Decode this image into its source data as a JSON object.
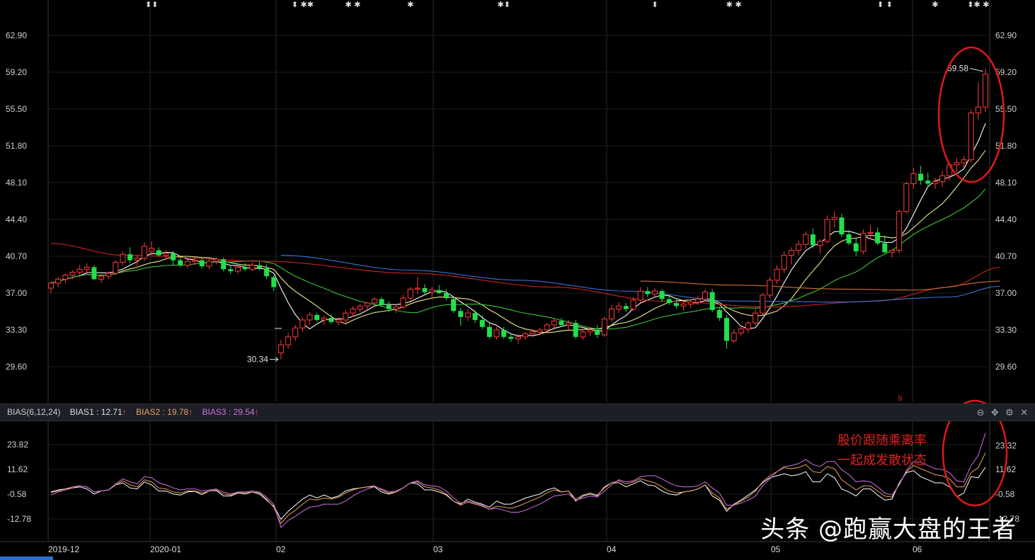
{
  "price_axis_ticks": [
    "62.90",
    "59.20",
    "55.50",
    "51.80",
    "48.10",
    "44.40",
    "40.70",
    "37.00",
    "33.30",
    "29.60"
  ],
  "bias_axis_ticks": [
    "23.82",
    "11.62",
    "-0.58",
    "-12.78"
  ],
  "bias_axis_ticks_right": [
    "23.32",
    "11.62",
    "-0.58",
    "-12.78"
  ],
  "date_labels": [
    "2019-12",
    "2020-01",
    "02",
    "03",
    "04",
    "05",
    "06"
  ],
  "indicator_bar": {
    "name": "BIAS(6,12,24)",
    "bias1": "BIAS1 : 12.71",
    "bias2": "BIAS2 : 19.78",
    "bias3": "BIAS3 : 29.54",
    "arrow": "↑"
  },
  "annotations": {
    "low_label": "30.34",
    "high_label": "59.58",
    "note_line1": "股价跟随乘离率",
    "note_line2": "一起成发散状态",
    "marker_9": "9"
  },
  "watermark": "头条 @跑赢大盘的王者",
  "colors": {
    "up": "#ff3b3b",
    "down": "#22e04a",
    "bias1": "#ffffff",
    "bias2": "#e8a060",
    "bias3": "#d070e0",
    "ma5": "#ffffff",
    "ma10": "#f0e68c",
    "ma20": "#3cc43c",
    "ma60": "#cc2222",
    "ma120": "#3a6fd8",
    "ma250": "#d07030"
  },
  "chart_data": {
    "type": "candlestick",
    "price_range": [
      27.5,
      64.5
    ],
    "candles_ohlc": [
      [
        37.5,
        38.2,
        37.0,
        38.0
      ],
      [
        38.0,
        38.6,
        37.6,
        38.4
      ],
      [
        38.4,
        39.0,
        38.0,
        38.8
      ],
      [
        38.8,
        39.3,
        38.4,
        39.1
      ],
      [
        39.1,
        39.8,
        38.6,
        39.4
      ],
      [
        39.4,
        40.0,
        38.9,
        39.6
      ],
      [
        39.6,
        39.8,
        38.3,
        38.4
      ],
      [
        38.4,
        38.9,
        38.0,
        38.7
      ],
      [
        38.7,
        39.2,
        38.4,
        39.0
      ],
      [
        39.0,
        40.3,
        38.8,
        40.1
      ],
      [
        40.1,
        41.2,
        39.8,
        40.9
      ],
      [
        40.9,
        41.6,
        40.0,
        40.3
      ],
      [
        40.3,
        40.8,
        39.7,
        40.5
      ],
      [
        40.5,
        42.1,
        40.2,
        41.7
      ],
      [
        41.2,
        42.2,
        40.8,
        41.5
      ],
      [
        41.3,
        41.6,
        40.7,
        40.8
      ],
      [
        40.8,
        41.3,
        40.3,
        41.0
      ],
      [
        41.0,
        41.2,
        39.8,
        40.3
      ],
      [
        40.3,
        40.6,
        39.6,
        39.8
      ],
      [
        39.8,
        40.4,
        39.5,
        40.2
      ],
      [
        40.2,
        40.6,
        39.8,
        40.3
      ],
      [
        40.3,
        40.5,
        39.5,
        39.7
      ],
      [
        39.7,
        40.5,
        39.4,
        40.2
      ],
      [
        40.2,
        40.6,
        39.9,
        40.4
      ],
      [
        40.4,
        40.6,
        39.2,
        39.4
      ],
      [
        39.4,
        39.7,
        38.9,
        39.2
      ],
      [
        39.2,
        39.8,
        38.9,
        39.6
      ],
      [
        39.6,
        40.0,
        39.2,
        39.4
      ],
      [
        39.4,
        40.1,
        39.2,
        39.8
      ],
      [
        39.8,
        40.2,
        39.3,
        39.5
      ],
      [
        39.5,
        39.9,
        38.4,
        38.7
      ],
      [
        38.6,
        38.8,
        37.2,
        37.6
      ],
      [
        31.0,
        32.3,
        30.34,
        31.8
      ],
      [
        31.8,
        33.0,
        31.4,
        32.6
      ],
      [
        32.6,
        33.8,
        32.2,
        33.5
      ],
      [
        33.5,
        34.6,
        33.1,
        34.3
      ],
      [
        34.3,
        35.1,
        33.8,
        34.8
      ],
      [
        34.8,
        35.0,
        34.1,
        34.3
      ],
      [
        34.3,
        34.7,
        33.8,
        34.5
      ],
      [
        34.5,
        34.9,
        33.9,
        34.1
      ],
      [
        34.1,
        34.6,
        33.7,
        34.3
      ],
      [
        34.3,
        35.3,
        34.0,
        35.0
      ],
      [
        35.0,
        35.7,
        34.6,
        35.4
      ],
      [
        35.4,
        35.9,
        35.1,
        35.7
      ],
      [
        35.7,
        36.1,
        35.3,
        36.0
      ],
      [
        36.0,
        36.6,
        35.6,
        36.4
      ],
      [
        36.4,
        36.6,
        35.6,
        35.8
      ],
      [
        35.8,
        36.2,
        35.1,
        35.4
      ],
      [
        35.4,
        35.9,
        35.0,
        35.6
      ],
      [
        35.6,
        36.8,
        35.4,
        36.5
      ],
      [
        36.5,
        37.6,
        36.2,
        37.4
      ],
      [
        37.4,
        38.6,
        36.9,
        37.5
      ],
      [
        37.5,
        37.9,
        36.8,
        37.1
      ],
      [
        37.1,
        37.6,
        36.5,
        37.3
      ],
      [
        37.3,
        37.8,
        36.9,
        37.0
      ],
      [
        37.0,
        37.4,
        36.3,
        36.5
      ],
      [
        36.4,
        36.6,
        35.0,
        35.2
      ],
      [
        35.2,
        35.5,
        33.7,
        34.6
      ],
      [
        34.6,
        35.4,
        34.2,
        35.0
      ],
      [
        35.0,
        35.3,
        34.0,
        34.3
      ],
      [
        34.3,
        34.8,
        33.4,
        33.6
      ],
      [
        33.6,
        34.0,
        32.4,
        32.6
      ],
      [
        32.6,
        33.6,
        32.3,
        33.3
      ],
      [
        33.3,
        33.6,
        32.4,
        32.6
      ],
      [
        32.6,
        33.0,
        32.1,
        32.4
      ],
      [
        32.4,
        32.9,
        31.9,
        32.6
      ],
      [
        32.6,
        33.1,
        32.3,
        32.9
      ],
      [
        32.9,
        33.4,
        32.6,
        33.1
      ],
      [
        33.1,
        33.5,
        32.8,
        33.3
      ],
      [
        33.3,
        34.0,
        33.0,
        33.8
      ],
      [
        33.8,
        34.4,
        33.5,
        34.2
      ],
      [
        34.2,
        34.5,
        33.6,
        33.8
      ],
      [
        33.8,
        34.3,
        33.3,
        34.0
      ],
      [
        34.0,
        34.3,
        32.4,
        32.6
      ],
      [
        32.6,
        33.4,
        32.3,
        33.1
      ],
      [
        33.1,
        33.6,
        32.7,
        33.3
      ],
      [
        33.3,
        33.8,
        32.5,
        32.8
      ],
      [
        32.8,
        34.6,
        32.6,
        34.4
      ],
      [
        34.4,
        35.8,
        34.1,
        35.4
      ],
      [
        35.4,
        36.1,
        35.0,
        35.7
      ],
      [
        35.7,
        36.0,
        35.1,
        35.4
      ],
      [
        35.4,
        36.6,
        35.2,
        36.3
      ],
      [
        36.3,
        37.6,
        36.0,
        37.2
      ],
      [
        37.2,
        37.6,
        36.6,
        36.9
      ],
      [
        36.9,
        37.5,
        36.6,
        37.2
      ],
      [
        37.2,
        37.4,
        36.1,
        36.4
      ],
      [
        36.4,
        36.8,
        35.8,
        36.0
      ],
      [
        36.0,
        36.5,
        35.4,
        35.7
      ],
      [
        35.7,
        36.2,
        35.2,
        35.9
      ],
      [
        35.9,
        36.4,
        35.5,
        36.1
      ],
      [
        36.1,
        36.7,
        35.8,
        36.4
      ],
      [
        36.4,
        37.4,
        36.2,
        37.1
      ],
      [
        37.1,
        37.4,
        35.1,
        35.3
      ],
      [
        35.3,
        35.6,
        34.2,
        34.5
      ],
      [
        34.5,
        34.8,
        31.4,
        32.2
      ],
      [
        32.2,
        33.3,
        32.0,
        33.0
      ],
      [
        33.0,
        33.6,
        32.7,
        33.4
      ],
      [
        33.4,
        34.2,
        33.0,
        34.0
      ],
      [
        34.0,
        35.4,
        33.8,
        35.0
      ],
      [
        35.0,
        37.0,
        34.8,
        36.8
      ],
      [
        36.8,
        38.6,
        36.5,
        38.3
      ],
      [
        38.3,
        39.8,
        37.9,
        39.4
      ],
      [
        39.4,
        41.2,
        39.0,
        40.8
      ],
      [
        40.8,
        41.6,
        39.9,
        41.3
      ],
      [
        41.3,
        42.3,
        40.8,
        41.9
      ],
      [
        41.9,
        43.2,
        41.5,
        42.9
      ],
      [
        42.9,
        43.5,
        41.5,
        41.8
      ],
      [
        41.8,
        42.4,
        41.0,
        42.2
      ],
      [
        42.2,
        44.8,
        42.0,
        44.4
      ],
      [
        44.4,
        45.2,
        43.6,
        44.6
      ],
      [
        44.6,
        45.0,
        42.6,
        42.9
      ],
      [
        42.9,
        43.3,
        41.8,
        42.0
      ],
      [
        42.0,
        42.6,
        40.7,
        41.2
      ],
      [
        41.2,
        43.4,
        40.9,
        43.0
      ],
      [
        43.0,
        43.8,
        42.4,
        43.1
      ],
      [
        43.1,
        43.6,
        41.8,
        42.0
      ],
      [
        42.0,
        42.8,
        40.9,
        41.1
      ],
      [
        41.1,
        41.4,
        40.6,
        41.3
      ],
      [
        41.3,
        45.4,
        41.0,
        45.2
      ],
      [
        45.2,
        48.2,
        45.0,
        48.0
      ],
      [
        48.0,
        49.6,
        47.5,
        49.0
      ],
      [
        49.0,
        49.8,
        47.9,
        48.3
      ],
      [
        48.3,
        49.1,
        47.6,
        48.0
      ],
      [
        48.0,
        48.6,
        47.5,
        48.2
      ],
      [
        48.2,
        49.3,
        47.7,
        48.8
      ],
      [
        48.8,
        50.2,
        48.3,
        49.9
      ],
      [
        49.9,
        50.6,
        49.2,
        50.1
      ],
      [
        50.1,
        50.8,
        49.6,
        50.4
      ],
      [
        50.4,
        55.4,
        50.1,
        55.1
      ],
      [
        55.1,
        58.2,
        54.4,
        55.7
      ],
      [
        55.7,
        59.58,
        55.2,
        59.0
      ]
    ],
    "bias_series": [
      {
        "name": "BIAS1",
        "color": "#ffffff",
        "values": [
          0.5,
          1.5,
          2.0,
          2.5,
          3.0,
          2.0,
          -0.5,
          1.0,
          1.5,
          4.0,
          5.0,
          2.5,
          2.0,
          5.5,
          4.0,
          1.0,
          1.0,
          -0.5,
          -1.0,
          0.5,
          0.8,
          -0.8,
          1.0,
          1.2,
          -1.5,
          -1.5,
          0.0,
          -0.5,
          0.5,
          -0.5,
          -3.5,
          -6.5,
          -13.0,
          -9.0,
          -6.0,
          -3.0,
          -1.0,
          -2.5,
          -1.0,
          -2.5,
          -1.5,
          1.0,
          2.0,
          2.5,
          3.0,
          3.0,
          0.5,
          -0.5,
          0.5,
          2.5,
          5.0,
          4.5,
          1.5,
          1.5,
          0.5,
          -1.0,
          -4.0,
          -5.5,
          -3.0,
          -4.5,
          -5.5,
          -7.0,
          -4.0,
          -5.5,
          -5.5,
          -4.0,
          -2.5,
          -1.5,
          -0.5,
          1.5,
          2.5,
          0.5,
          1.0,
          -4.0,
          -1.5,
          -0.5,
          -1.5,
          3.0,
          5.0,
          5.0,
          3.0,
          4.5,
          6.0,
          4.0,
          3.5,
          1.0,
          -0.5,
          -1.0,
          0.5,
          1.0,
          2.0,
          4.0,
          -1.5,
          -3.5,
          -9.0,
          -5.5,
          -3.5,
          -1.0,
          1.5,
          5.0,
          7.5,
          8.5,
          9.5,
          8.5,
          9.0,
          10.5,
          5.5,
          5.5,
          9.5,
          7.5,
          2.0,
          0.5,
          -1.5,
          2.0,
          2.0,
          -1.0,
          -3.5,
          -3.0,
          5.0,
          10.0,
          11.0,
          8.0,
          6.5,
          5.0,
          5.0,
          3.0,
          -2.0,
          0.0,
          8.0,
          7.5,
          12.71
        ]
      },
      {
        "name": "BIAS2",
        "color": "#e8a060",
        "values": [
          0.2,
          1.0,
          2.0,
          3.0,
          3.5,
          3.0,
          0.5,
          1.0,
          1.5,
          4.0,
          6.0,
          4.0,
          3.0,
          6.5,
          5.5,
          2.5,
          2.0,
          0.5,
          0.0,
          1.0,
          1.0,
          0.0,
          1.0,
          1.5,
          -0.5,
          -1.0,
          0.5,
          0.0,
          0.5,
          0.0,
          -3.0,
          -7.0,
          -15.0,
          -11.0,
          -8.5,
          -5.5,
          -3.0,
          -3.5,
          -2.5,
          -3.0,
          -2.0,
          0.0,
          1.5,
          2.5,
          3.0,
          3.5,
          1.5,
          0.0,
          0.5,
          2.5,
          5.0,
          5.5,
          3.0,
          2.5,
          1.5,
          -0.5,
          -4.0,
          -6.0,
          -4.5,
          -5.5,
          -6.5,
          -8.0,
          -6.5,
          -7.0,
          -7.5,
          -6.5,
          -5.0,
          -3.5,
          -2.0,
          0.0,
          1.5,
          0.5,
          1.0,
          -3.0,
          -1.0,
          0.0,
          -1.0,
          2.5,
          5.0,
          6.0,
          4.5,
          5.5,
          7.0,
          6.0,
          5.0,
          3.0,
          1.0,
          0.0,
          0.5,
          1.0,
          2.0,
          4.0,
          0.0,
          -2.5,
          -8.0,
          -6.0,
          -4.0,
          -2.0,
          1.0,
          5.5,
          8.5,
          10.5,
          12.5,
          12.0,
          12.5,
          14.0,
          10.5,
          10.0,
          13.0,
          12.0,
          6.5,
          4.0,
          1.5,
          3.5,
          3.5,
          1.0,
          -1.5,
          -2.0,
          4.5,
          10.5,
          13.5,
          12.0,
          10.5,
          9.0,
          8.5,
          7.0,
          3.0,
          3.0,
          10.0,
          12.5,
          19.78
        ]
      },
      {
        "name": "BIAS3",
        "color": "#d070e0",
        "values": [
          -1.0,
          0.5,
          1.5,
          2.5,
          3.5,
          3.0,
          0.5,
          1.0,
          1.5,
          4.5,
          7.0,
          5.5,
          4.5,
          8.0,
          7.5,
          5.0,
          4.0,
          2.5,
          1.5,
          2.0,
          2.0,
          1.0,
          1.5,
          2.0,
          0.5,
          -0.5,
          0.5,
          0.5,
          1.0,
          0.5,
          -2.0,
          -5.5,
          -17.0,
          -13.5,
          -11.5,
          -9.0,
          -7.0,
          -6.5,
          -5.5,
          -5.5,
          -5.5,
          -4.0,
          -1.5,
          0.5,
          2.0,
          3.0,
          2.0,
          0.5,
          1.0,
          2.5,
          5.0,
          6.0,
          4.0,
          3.5,
          3.0,
          1.0,
          -2.5,
          -5.0,
          -4.0,
          -5.0,
          -6.0,
          -8.0,
          -7.5,
          -8.5,
          -9.5,
          -9.5,
          -8.5,
          -7.0,
          -5.5,
          -3.5,
          -1.5,
          -1.0,
          -0.5,
          -3.5,
          -2.5,
          -1.5,
          -2.0,
          1.0,
          4.0,
          6.5,
          5.5,
          6.0,
          8.0,
          8.5,
          8.5,
          7.0,
          5.0,
          3.5,
          3.0,
          3.0,
          3.5,
          5.5,
          2.5,
          0.0,
          -6.0,
          -6.0,
          -5.0,
          -3.5,
          -1.5,
          3.5,
          7.0,
          10.5,
          13.0,
          13.5,
          14.5,
          16.5,
          14.0,
          13.0,
          15.5,
          15.5,
          11.5,
          9.0,
          5.5,
          6.0,
          5.5,
          3.0,
          0.0,
          -1.0,
          4.0,
          11.0,
          15.5,
          15.0,
          13.5,
          12.0,
          11.5,
          10.0,
          6.0,
          5.5,
          13.5,
          18.5,
          29.54
        ]
      }
    ],
    "ma_series": [
      {
        "name": "MA5",
        "color": "#ffffff",
        "kind": "ma",
        "period": 5
      },
      {
        "name": "MA10",
        "color": "#f0e68c",
        "kind": "ma",
        "period": 10
      },
      {
        "name": "MA20",
        "color": "#3cc43c",
        "kind": "ma",
        "period": 20
      },
      {
        "name": "MA60",
        "color": "#cc2222",
        "kind": "smooth",
        "values": [
          [
            0,
            42.0
          ],
          [
            10,
            40.8
          ],
          [
            30,
            40.2
          ],
          [
            50,
            39.0
          ],
          [
            70,
            37.6
          ],
          [
            85,
            36.2
          ],
          [
            100,
            35.6
          ],
          [
            115,
            36.2
          ],
          [
            125,
            37.6
          ],
          [
            132,
            39.6
          ]
        ]
      },
      {
        "name": "MA120",
        "color": "#3a6fd8",
        "kind": "smooth",
        "values": [
          [
            32,
            40.8
          ],
          [
            50,
            39.3
          ],
          [
            65,
            38.3
          ],
          [
            80,
            37.2
          ],
          [
            95,
            36.2
          ],
          [
            110,
            36.1
          ],
          [
            125,
            36.6
          ],
          [
            132,
            37.7
          ]
        ]
      },
      {
        "name": "MA250",
        "color": "#d07030",
        "kind": "smooth",
        "values": [
          [
            82,
            38.2
          ],
          [
            95,
            37.8
          ],
          [
            110,
            37.4
          ],
          [
            120,
            37.3
          ],
          [
            132,
            38.2
          ]
        ]
      }
    ],
    "markers_row": [
      [
        14,
        "⬍⬍"
      ],
      [
        35,
        "⬍ ✱✱"
      ],
      [
        42,
        "✱ ✱"
      ],
      [
        50,
        "✱"
      ],
      [
        63,
        "✱⬍"
      ],
      [
        84,
        "⬍"
      ],
      [
        95,
        "✱ ✱"
      ],
      [
        116,
        "⬍ ⬍"
      ],
      [
        123,
        "✱"
      ],
      [
        129,
        "⬍✱ ✱"
      ]
    ],
    "x_axis": [
      "2019-12",
      "2020-01",
      "02",
      "03",
      "04",
      "05",
      "06"
    ]
  }
}
